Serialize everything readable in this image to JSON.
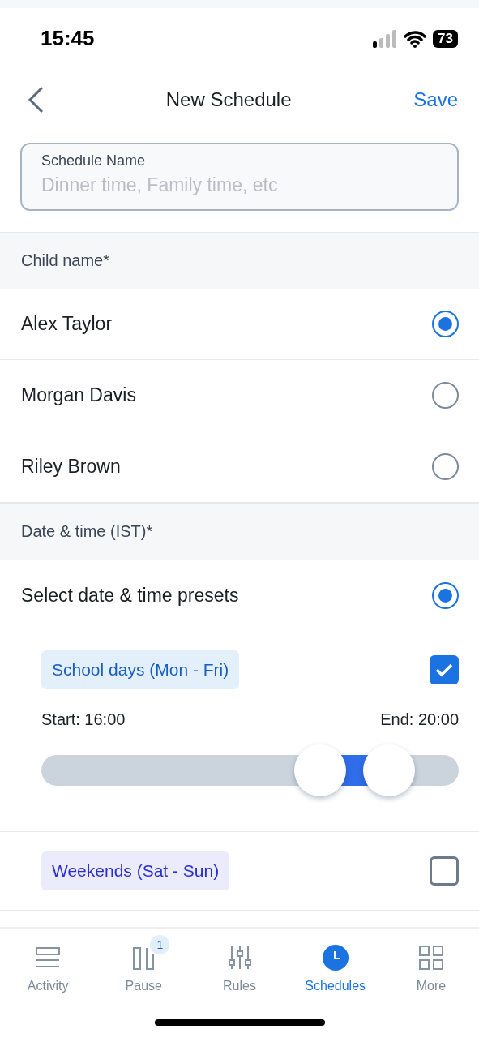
{
  "status_bar": {
    "time": "15:45",
    "battery": "73"
  },
  "nav": {
    "title": "New Schedule",
    "action": "Save"
  },
  "name_field": {
    "label": "Schedule Name",
    "placeholder": "Dinner time, Family time, etc"
  },
  "child_section": {
    "title": "Child name*",
    "children": [
      {
        "name": "Alex Taylor",
        "selected": true
      },
      {
        "name": "Morgan Davis",
        "selected": false
      },
      {
        "name": "Riley Brown",
        "selected": false
      }
    ]
  },
  "date_section": {
    "title": "Date & time (IST)*",
    "option": {
      "label": "Select date & time presets",
      "selected": true
    },
    "presets": [
      {
        "label": "School days (Mon - Fri)",
        "checked": true,
        "color": "#e3f0fc",
        "start": "Start: 16:00",
        "end": "End: 20:00",
        "slider": {
          "thumbs": [
            {
              "level": 0.667
            },
            {
              "level": 0.833
            }
          ]
        }
      },
      {
        "label": "Weekends (Sat - Sun)",
        "checked": false,
        "color": "#ecebfb"
      }
    ]
  },
  "tab_bar": [
    {
      "label": "Activity",
      "kind": "activity",
      "selected": false
    },
    {
      "label": "Pause",
      "kind": "pause",
      "selected": false,
      "badge": "1"
    },
    {
      "label": "Rules",
      "kind": "rules",
      "selected": false
    },
    {
      "label": "Schedules",
      "kind": "schedules",
      "selected": true
    },
    {
      "label": "More",
      "kind": "more",
      "selected": false
    }
  ]
}
